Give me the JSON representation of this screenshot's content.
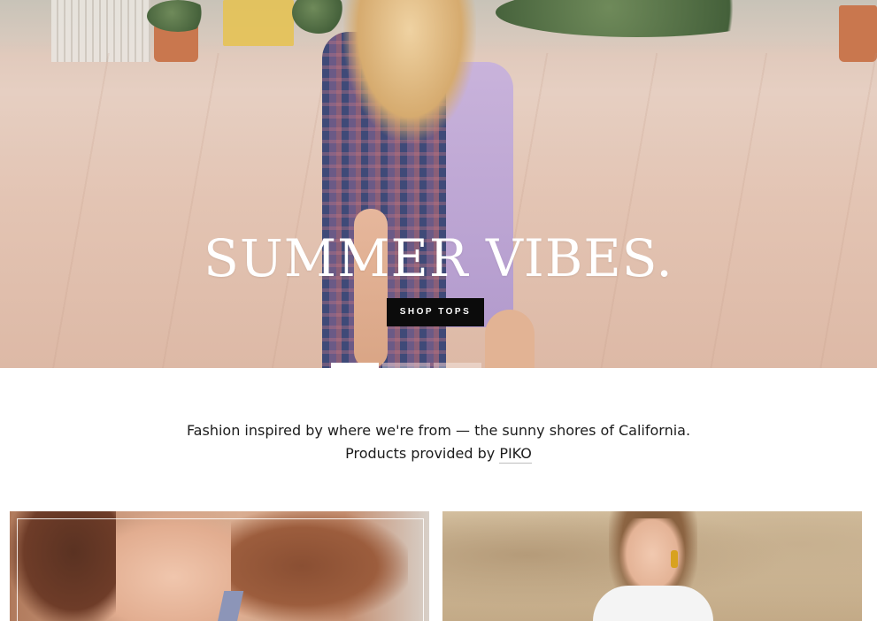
{
  "hero": {
    "title": "SUMMER VIBES.",
    "button_label": "SHOP TOPS",
    "slide_count": 3,
    "active_slide": 1
  },
  "intro": {
    "line1": "Fashion inspired by where we're from — the sunny shores of California.",
    "line2_prefix": "Products provided by",
    "link_label": "PIKO"
  },
  "colors": {
    "button_bg": "#0b0b0b",
    "button_text": "#ffffff",
    "body_text": "#1c1c1c",
    "page_bg": "#ffffff"
  }
}
